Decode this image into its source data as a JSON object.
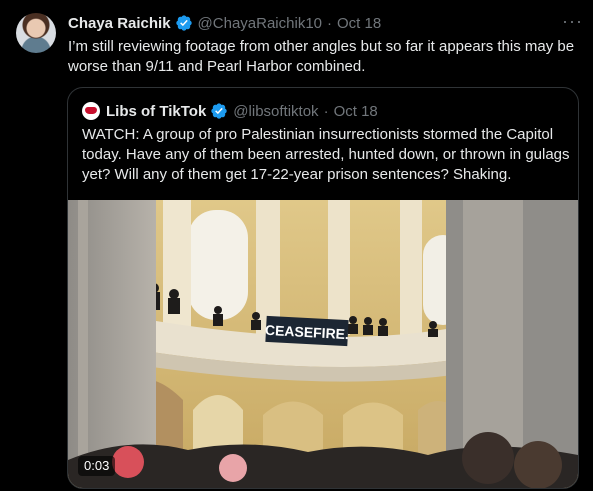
{
  "tweet": {
    "author_name": "Chaya Raichik",
    "author_handle": "@ChayaRaichik10",
    "separator": "·",
    "date": "Oct 18",
    "more_label": "···",
    "text": "I’m still reviewing footage from other angles but so far it appears this may be worse than 9/11 and Pearl Harbor combined."
  },
  "quoted": {
    "author_name": "Libs of TikTok",
    "author_handle": "@libsoftiktok",
    "separator": "·",
    "date": "Oct 18",
    "text": "WATCH: A group of pro Palestinian insurrectionists stormed the Capitol today. Have any of them been arrested, hunted down, or thrown in gulags yet? Will any of them get 17-22-year prison sentences? Shaking.",
    "video": {
      "banner_text": "CEASEFIRE.",
      "timestamp": "0:03"
    }
  },
  "colors": {
    "background": "#000000",
    "text": "#e7e9ea",
    "muted": "#71767b",
    "verified": "#1d9bf0",
    "border": "#2f3336"
  },
  "icons": [
    "verified-badge-icon",
    "more-options-icon"
  ]
}
